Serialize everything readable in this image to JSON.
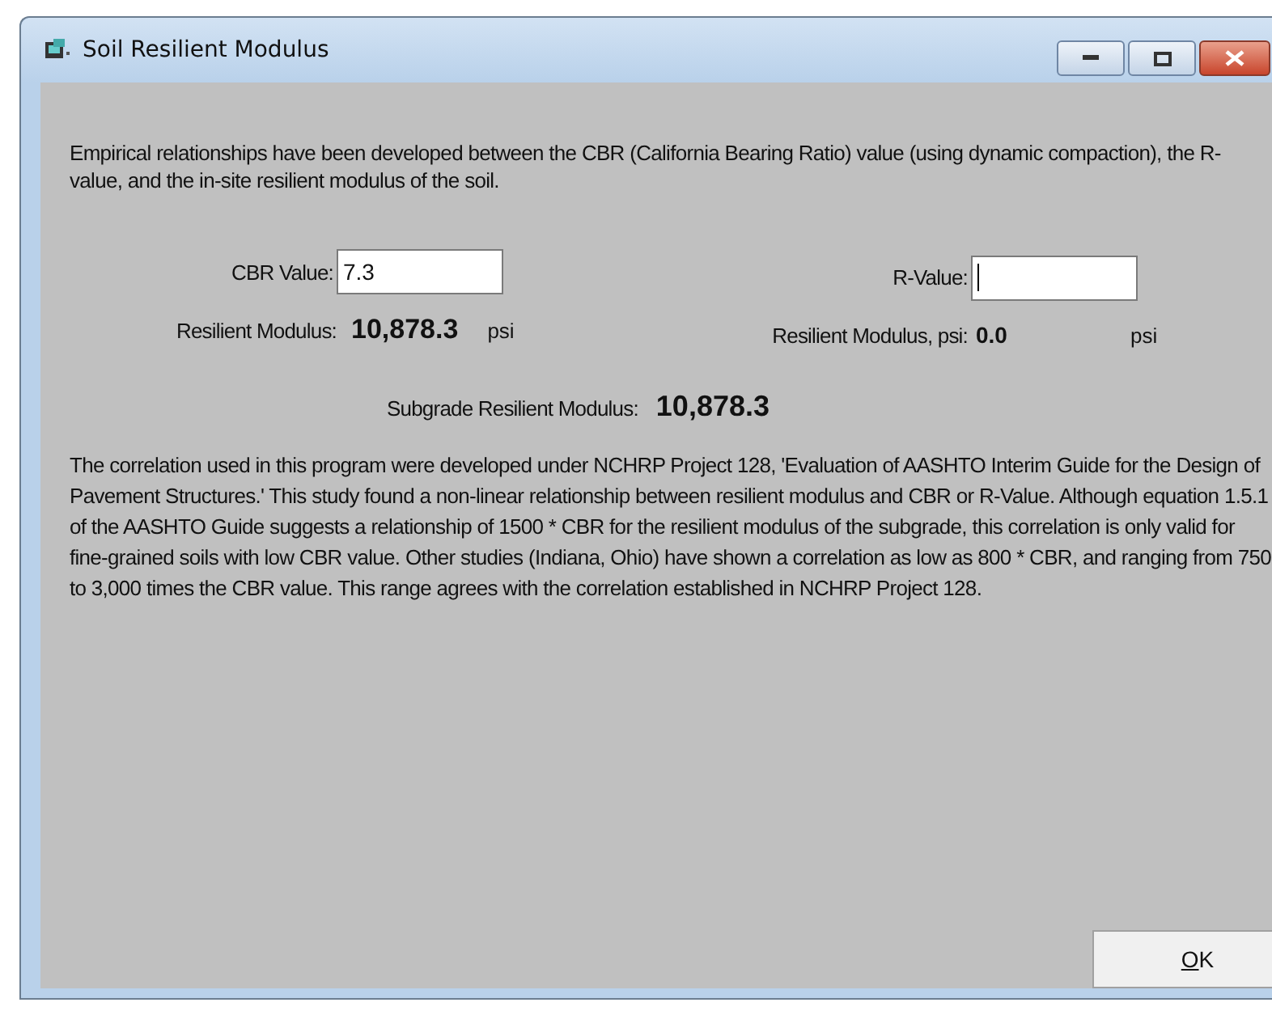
{
  "window": {
    "title": "Soil Resilient Modulus"
  },
  "intro": "Empirical relationships have been developed between the CBR (California Bearing Ratio) value (using dynamic compaction), the R-value, and the in-site resilient modulus of the soil.",
  "cbr": {
    "label": "CBR Value:",
    "value": "7.3",
    "focused": false,
    "result_label": "Resilient Modulus:",
    "result": "10,878.3",
    "unit": "psi"
  },
  "r_value": {
    "label": "R-Value:",
    "focused": true,
    "result_label": "Resilient Modulus, psi:",
    "result": "0.0",
    "unit": "psi"
  },
  "subgrade": {
    "label": "Subgrade Resilient Modulus:",
    "value": "10,878.3"
  },
  "note": "The correlation used in this program were developed under NCHRP Project 128, 'Evaluation of AASHTO Interim Guide for the Design of Pavement Structures.'  This study found a non-linear relationship between resilient modulus and CBR or R-Value.  Although equation 1.5.1 of the AASHTO Guide suggests a relationship of 1500 * CBR for the resilient modulus of the subgrade, this correlation is only valid for fine-grained soils with low CBR value.  Other studies (Indiana, Ohio) have shown a correlation as low as 800 * CBR, and ranging from 750 to 3,000 times the CBR value.  This range agrees with the correlation established in NCHRP Project 128.",
  "buttons": [
    {
      "label": "OK"
    }
  ]
}
